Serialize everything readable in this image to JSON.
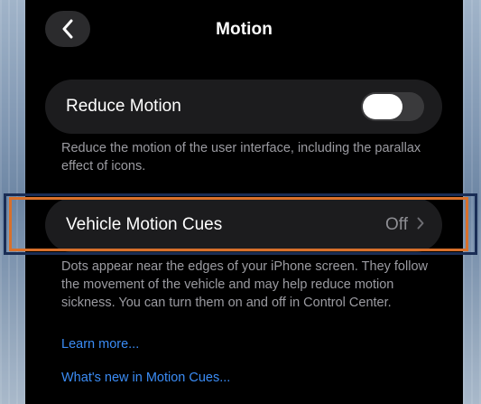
{
  "header": {
    "title": "Motion",
    "back_icon": "chevron-left-icon"
  },
  "reduce_motion": {
    "label": "Reduce Motion",
    "enabled": false,
    "description": "Reduce the motion of the user interface, including the parallax effect of icons."
  },
  "vehicle_motion_cues": {
    "label": "Vehicle Motion Cues",
    "value": "Off",
    "chevron_icon": "chevron-right-icon",
    "description": "Dots appear near the edges of your iPhone screen. They follow the movement of the vehicle and may help reduce motion sickness. You can turn them on and off in Control Center."
  },
  "links": {
    "learn_more": "Learn more...",
    "whats_new": "What's new in Motion Cues..."
  },
  "colors": {
    "background": "#000000",
    "cell": "#1c1c1e",
    "link": "#3b8cf5",
    "secondary_text": "#9b9ba1",
    "highlight_outer": "#1a2d55",
    "highlight_inner": "#d8702b"
  }
}
